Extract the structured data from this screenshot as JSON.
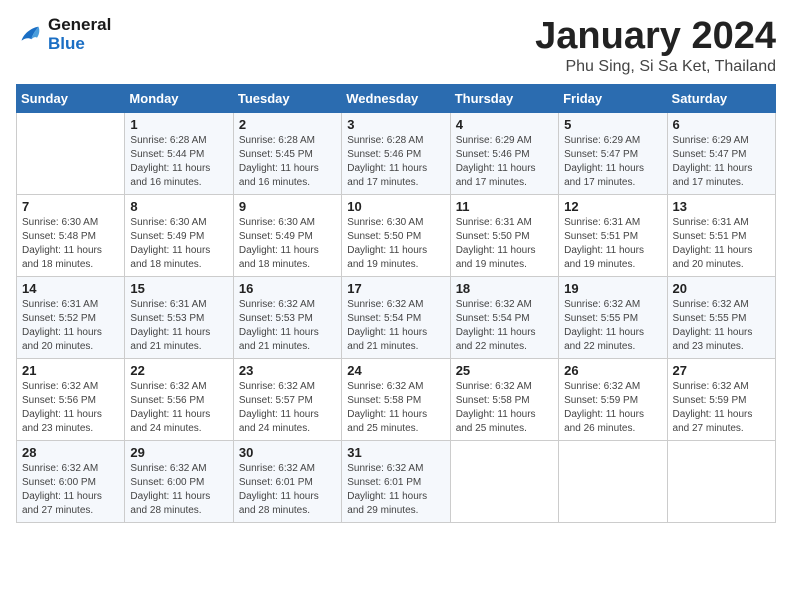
{
  "logo": {
    "line1": "General",
    "line2": "Blue"
  },
  "title": "January 2024",
  "subtitle": "Phu Sing, Si Sa Ket, Thailand",
  "weekdays": [
    "Sunday",
    "Monday",
    "Tuesday",
    "Wednesday",
    "Thursday",
    "Friday",
    "Saturday"
  ],
  "weeks": [
    [
      {
        "day": "",
        "info": ""
      },
      {
        "day": "1",
        "info": "Sunrise: 6:28 AM\nSunset: 5:44 PM\nDaylight: 11 hours\nand 16 minutes."
      },
      {
        "day": "2",
        "info": "Sunrise: 6:28 AM\nSunset: 5:45 PM\nDaylight: 11 hours\nand 16 minutes."
      },
      {
        "day": "3",
        "info": "Sunrise: 6:28 AM\nSunset: 5:46 PM\nDaylight: 11 hours\nand 17 minutes."
      },
      {
        "day": "4",
        "info": "Sunrise: 6:29 AM\nSunset: 5:46 PM\nDaylight: 11 hours\nand 17 minutes."
      },
      {
        "day": "5",
        "info": "Sunrise: 6:29 AM\nSunset: 5:47 PM\nDaylight: 11 hours\nand 17 minutes."
      },
      {
        "day": "6",
        "info": "Sunrise: 6:29 AM\nSunset: 5:47 PM\nDaylight: 11 hours\nand 17 minutes."
      }
    ],
    [
      {
        "day": "7",
        "info": "Sunrise: 6:30 AM\nSunset: 5:48 PM\nDaylight: 11 hours\nand 18 minutes."
      },
      {
        "day": "8",
        "info": "Sunrise: 6:30 AM\nSunset: 5:49 PM\nDaylight: 11 hours\nand 18 minutes."
      },
      {
        "day": "9",
        "info": "Sunrise: 6:30 AM\nSunset: 5:49 PM\nDaylight: 11 hours\nand 18 minutes."
      },
      {
        "day": "10",
        "info": "Sunrise: 6:30 AM\nSunset: 5:50 PM\nDaylight: 11 hours\nand 19 minutes."
      },
      {
        "day": "11",
        "info": "Sunrise: 6:31 AM\nSunset: 5:50 PM\nDaylight: 11 hours\nand 19 minutes."
      },
      {
        "day": "12",
        "info": "Sunrise: 6:31 AM\nSunset: 5:51 PM\nDaylight: 11 hours\nand 19 minutes."
      },
      {
        "day": "13",
        "info": "Sunrise: 6:31 AM\nSunset: 5:51 PM\nDaylight: 11 hours\nand 20 minutes."
      }
    ],
    [
      {
        "day": "14",
        "info": "Sunrise: 6:31 AM\nSunset: 5:52 PM\nDaylight: 11 hours\nand 20 minutes."
      },
      {
        "day": "15",
        "info": "Sunrise: 6:31 AM\nSunset: 5:53 PM\nDaylight: 11 hours\nand 21 minutes."
      },
      {
        "day": "16",
        "info": "Sunrise: 6:32 AM\nSunset: 5:53 PM\nDaylight: 11 hours\nand 21 minutes."
      },
      {
        "day": "17",
        "info": "Sunrise: 6:32 AM\nSunset: 5:54 PM\nDaylight: 11 hours\nand 21 minutes."
      },
      {
        "day": "18",
        "info": "Sunrise: 6:32 AM\nSunset: 5:54 PM\nDaylight: 11 hours\nand 22 minutes."
      },
      {
        "day": "19",
        "info": "Sunrise: 6:32 AM\nSunset: 5:55 PM\nDaylight: 11 hours\nand 22 minutes."
      },
      {
        "day": "20",
        "info": "Sunrise: 6:32 AM\nSunset: 5:55 PM\nDaylight: 11 hours\nand 23 minutes."
      }
    ],
    [
      {
        "day": "21",
        "info": "Sunrise: 6:32 AM\nSunset: 5:56 PM\nDaylight: 11 hours\nand 23 minutes."
      },
      {
        "day": "22",
        "info": "Sunrise: 6:32 AM\nSunset: 5:56 PM\nDaylight: 11 hours\nand 24 minutes."
      },
      {
        "day": "23",
        "info": "Sunrise: 6:32 AM\nSunset: 5:57 PM\nDaylight: 11 hours\nand 24 minutes."
      },
      {
        "day": "24",
        "info": "Sunrise: 6:32 AM\nSunset: 5:58 PM\nDaylight: 11 hours\nand 25 minutes."
      },
      {
        "day": "25",
        "info": "Sunrise: 6:32 AM\nSunset: 5:58 PM\nDaylight: 11 hours\nand 25 minutes."
      },
      {
        "day": "26",
        "info": "Sunrise: 6:32 AM\nSunset: 5:59 PM\nDaylight: 11 hours\nand 26 minutes."
      },
      {
        "day": "27",
        "info": "Sunrise: 6:32 AM\nSunset: 5:59 PM\nDaylight: 11 hours\nand 27 minutes."
      }
    ],
    [
      {
        "day": "28",
        "info": "Sunrise: 6:32 AM\nSunset: 6:00 PM\nDaylight: 11 hours\nand 27 minutes."
      },
      {
        "day": "29",
        "info": "Sunrise: 6:32 AM\nSunset: 6:00 PM\nDaylight: 11 hours\nand 28 minutes."
      },
      {
        "day": "30",
        "info": "Sunrise: 6:32 AM\nSunset: 6:01 PM\nDaylight: 11 hours\nand 28 minutes."
      },
      {
        "day": "31",
        "info": "Sunrise: 6:32 AM\nSunset: 6:01 PM\nDaylight: 11 hours\nand 29 minutes."
      },
      {
        "day": "",
        "info": ""
      },
      {
        "day": "",
        "info": ""
      },
      {
        "day": "",
        "info": ""
      }
    ]
  ]
}
